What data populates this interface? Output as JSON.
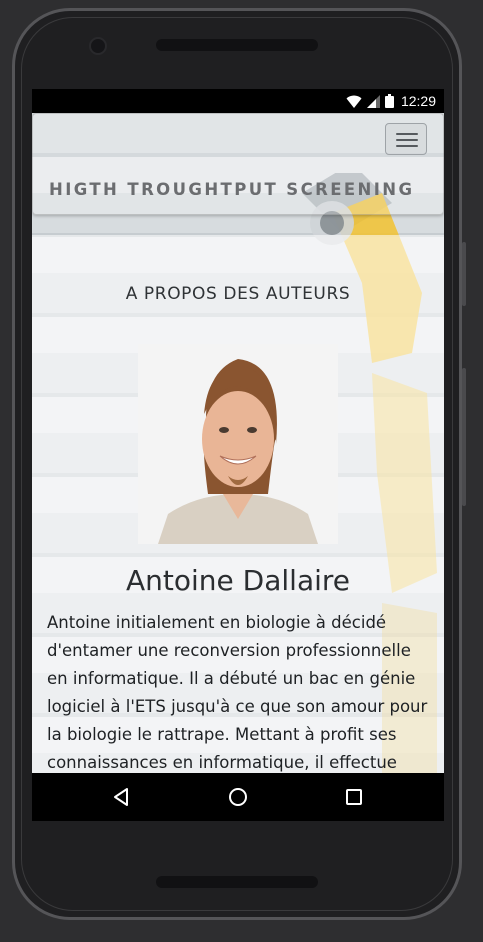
{
  "status_bar": {
    "time": "12:29",
    "icons": [
      "wifi-icon",
      "cellular-signal-icon",
      "battery-icon"
    ]
  },
  "navbar": {
    "brand": "HIGTH TROUGHTPUT SCREENING",
    "menu_icon": "hamburger-menu-icon"
  },
  "section": {
    "title": "A PROPOS DES AUTEURS"
  },
  "author": {
    "name": "Antoine Dallaire",
    "bio": "Antoine initialement en biologie à décidé d'entamer une reconversion professionnelle en informatique. Il a débuté un bac en génie logiciel à l'ETS jusqu'à ce que son amour pour la biologie le rattrape. Mettant à profit ses connaissances en informatique, il effectue"
  },
  "system_nav": {
    "back_icon": "back-triangle-icon",
    "home_icon": "home-circle-icon",
    "recents_icon": "recents-square-icon"
  },
  "colors": {
    "brand_text": "#6b6d70",
    "status_bar": "#000000",
    "robot_arm": "#f2c230"
  }
}
